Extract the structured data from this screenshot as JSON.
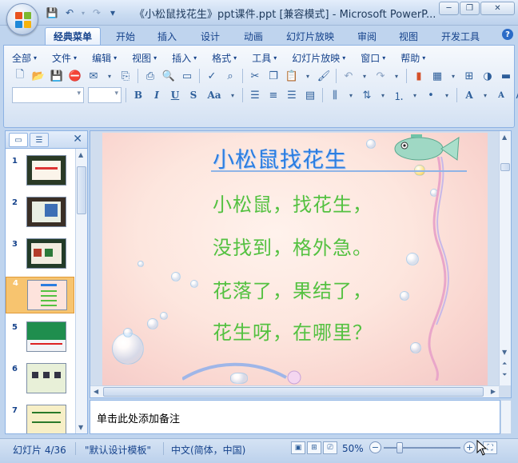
{
  "window": {
    "title": "《小松鼠找花生》ppt课件.ppt [兼容模式] - Microsoft PowerP...",
    "minimize": "─",
    "restore": "❐",
    "close": "✕"
  },
  "qat": {
    "save": "💾",
    "undo": "↶",
    "redo": "↷",
    "customize": "▾"
  },
  "tabs": [
    {
      "label": "经典菜单",
      "active": true
    },
    {
      "label": "开始"
    },
    {
      "label": "插入"
    },
    {
      "label": "设计"
    },
    {
      "label": "动画"
    },
    {
      "label": "幻灯片放映"
    },
    {
      "label": "审阅"
    },
    {
      "label": "视图"
    },
    {
      "label": "开发工具"
    }
  ],
  "help": "?",
  "menus": [
    "全部",
    "文件",
    "编辑",
    "视图",
    "插入",
    "格式",
    "工具",
    "幻灯片放映",
    "窗口",
    "帮助"
  ],
  "menu_arrow": "▾",
  "format_buttons": {
    "bold": "B",
    "italic": "I",
    "underline": "U",
    "strike": "S",
    "case": "Aa"
  },
  "font_size_buttons": {
    "increase": "A",
    "decrease": "A"
  },
  "left_pane": {
    "close": "✕",
    "slides": [
      {
        "num": "1"
      },
      {
        "num": "2"
      },
      {
        "num": "3"
      },
      {
        "num": "4",
        "selected": true
      },
      {
        "num": "5"
      },
      {
        "num": "6"
      },
      {
        "num": "7"
      }
    ]
  },
  "slide": {
    "title": "小松鼠找花生",
    "lines": [
      "小松鼠，找花生，",
      "没找到，格外急。",
      "花落了，果结了，",
      "花生呀，在哪里？"
    ],
    "title_color": "#2c7de0",
    "text_color": "#54c141"
  },
  "notes": {
    "placeholder": "单击此处添加备注"
  },
  "status": {
    "slide_info": "幻灯片 4/36",
    "template": "\"默认设计模板\"",
    "language": "中文(简体，中国)",
    "zoom": "50%"
  }
}
